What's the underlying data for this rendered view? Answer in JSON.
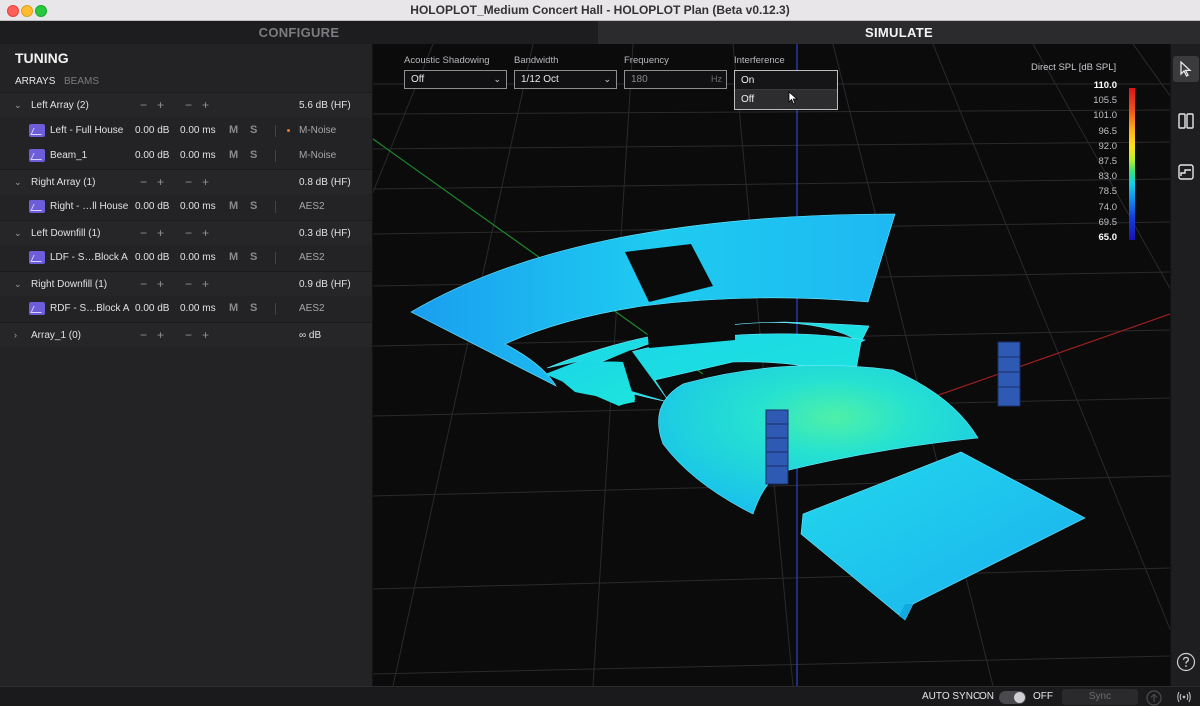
{
  "window": {
    "title": "HOLOPLOT_Medium Concert Hall - HOLOPLOT Plan (Beta v0.12.3)"
  },
  "modes": {
    "configure": "CONFIGURE",
    "simulate": "SIMULATE"
  },
  "panel": {
    "title": "TUNING",
    "tabs": {
      "arrays": "ARRAYS",
      "beams": "BEAMS"
    },
    "groups": [
      {
        "name": "Left Array (2)",
        "value": "5.6 dB (HF)",
        "items": [
          {
            "name": "Left - Full House",
            "db": "0.00 dB",
            "ms": "0.00 ms",
            "signal": "M-Noise"
          },
          {
            "name": "Beam_1",
            "db": "0.00 dB",
            "ms": "0.00 ms",
            "signal": "M-Noise"
          }
        ]
      },
      {
        "name": "Right Array (1)",
        "value": "0.8 dB (HF)",
        "items": [
          {
            "name": "Right - …ll House",
            "db": "0.00 dB",
            "ms": "0.00 ms",
            "signal": "AES2"
          }
        ]
      },
      {
        "name": "Left Downfill (1)",
        "value": "0.3 dB (HF)",
        "items": [
          {
            "name": "LDF - S…Block A",
            "db": "0.00 dB",
            "ms": "0.00 ms",
            "signal": "AES2"
          }
        ]
      },
      {
        "name": "Right Downfill (1)",
        "value": "0.9 dB (HF)",
        "items": [
          {
            "name": "RDF - S…Block A",
            "db": "0.00 dB",
            "ms": "0.00 ms",
            "signal": "AES2"
          }
        ]
      },
      {
        "name": "Array_1 (0)",
        "value": "∞ dB",
        "items": []
      }
    ],
    "mute_label": "M",
    "solo_label": "S",
    "minus": "−",
    "plus": "+"
  },
  "controls": {
    "acoustic_shadowing": {
      "label": "Acoustic Shadowing",
      "value": "Off"
    },
    "bandwidth": {
      "label": "Bandwidth",
      "value": "1/12 Oct"
    },
    "frequency": {
      "label": "Frequency",
      "value": "180",
      "unit": "Hz"
    },
    "interference": {
      "label": "Interference",
      "options": [
        "On",
        "Off"
      ],
      "highlighted": "Off"
    }
  },
  "legend": {
    "title": "Direct SPL [dB SPL]",
    "ticks": [
      "110.0",
      "105.5",
      "101.0",
      "96.5",
      "92.0",
      "87.5",
      "83.0",
      "78.5",
      "74.0",
      "69.5",
      "65.0"
    ],
    "colors": {
      "max": "#d8141a",
      "mid": "#ffe11a",
      "low": "#12d0e8",
      "min": "#1a10b4"
    }
  },
  "status": {
    "auto_sync": "AUTO SYNC",
    "on": "ON",
    "off": "OFF",
    "sync": "Sync"
  }
}
